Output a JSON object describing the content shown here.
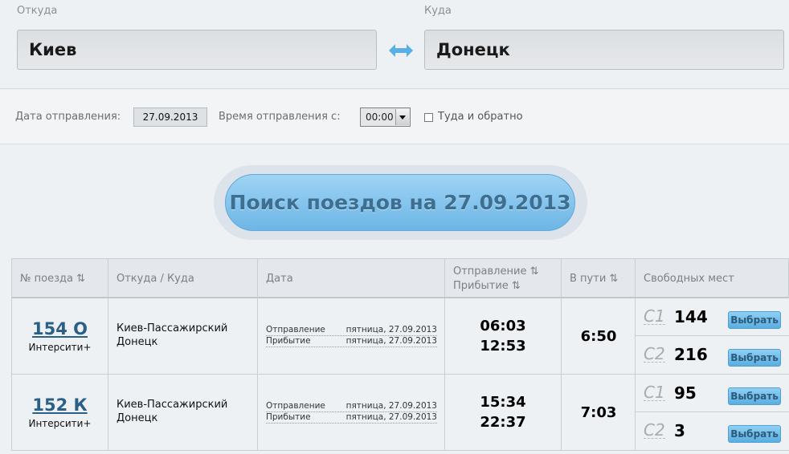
{
  "route": {
    "from_label": "Откуда",
    "from_value": "Киев",
    "to_label": "Куда",
    "to_value": "Донецк"
  },
  "options": {
    "date_label": "Дата отправления:",
    "date_value": "27.09.2013",
    "time_label": "Время отправления с:",
    "time_value": "00:00",
    "roundtrip_label": "Туда и обратно"
  },
  "search_button": "Поиск поездов на 27.09.2013",
  "table": {
    "headers": {
      "train": "№ поезда ⇅",
      "route": "Откуда / Куда",
      "date": "Дата",
      "depart": "Отправление ⇅",
      "arrive": "Прибытие ⇅",
      "duration": "В пути ⇅",
      "seats": "Свободных мест"
    },
    "rows": [
      {
        "train_no": "154 О",
        "category": "Интерсити+",
        "from": "Киев-Пассажирский",
        "to": "Донецк",
        "dep_label": "Отправление",
        "dep_date": "пятница, 27.09.2013",
        "arr_label": "Прибытие",
        "arr_date": "пятница, 27.09.2013",
        "dep_time": "06:03",
        "arr_time": "12:53",
        "duration": "6:50",
        "seats": [
          {
            "cls": "С1",
            "count": "144",
            "btn": "Выбрать"
          },
          {
            "cls": "С2",
            "count": "216",
            "btn": "Выбрать"
          }
        ]
      },
      {
        "train_no": "152 К",
        "category": "Интерсити+",
        "from": "Киев-Пассажирский",
        "to": "Донецк",
        "dep_label": "Отправление",
        "dep_date": "пятница, 27.09.2013",
        "arr_label": "Прибытие",
        "arr_date": "пятница, 27.09.2013",
        "dep_time": "15:34",
        "arr_time": "22:37",
        "duration": "7:03",
        "seats": [
          {
            "cls": "С1",
            "count": "95",
            "btn": "Выбрать"
          },
          {
            "cls": "С2",
            "count": "3",
            "btn": "Выбрать"
          }
        ]
      }
    ]
  }
}
